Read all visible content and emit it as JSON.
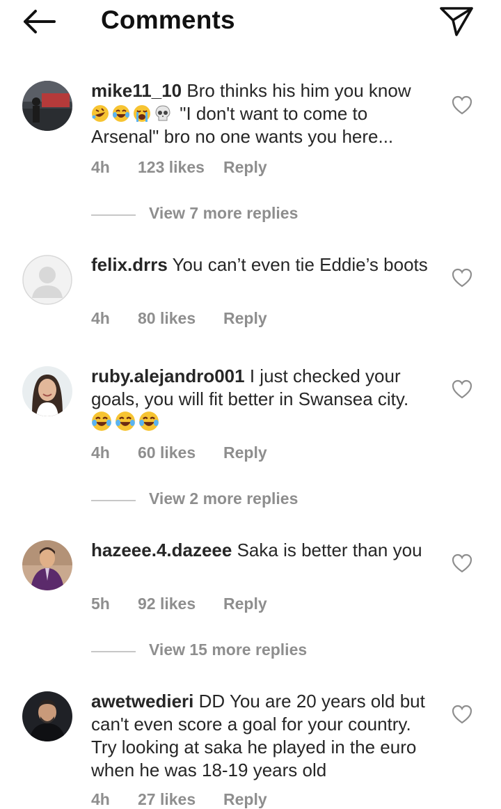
{
  "header": {
    "title": "Comments",
    "back_icon": "arrow-left-icon",
    "share_icon": "paper-plane-icon"
  },
  "comments": [
    {
      "username": "mike11_10",
      "text_before": "Bro thinks his him you know",
      "emojis": [
        "rolling-on-floor-laughing-emoji",
        "tears-of-joy-emoji",
        "loudly-crying-emoji",
        "skull-emoji"
      ],
      "text_after": " \"I don't want to come to Arsenal\" bro no one wants you here...",
      "time": "4h",
      "likes": "123 likes",
      "reply": "Reply",
      "view_more": "View 7 more replies"
    },
    {
      "username": "felix.drrs",
      "text": "You can’t even tie Eddie’s boots",
      "time": "4h",
      "likes": "80 likes",
      "reply": "Reply"
    },
    {
      "username": "ruby.alejandro001",
      "text": "I just checked your goals, you will fit better in Swansea city.",
      "emojis": [
        "tears-of-joy-emoji",
        "tears-of-joy-emoji",
        "tears-of-joy-emoji"
      ],
      "time": "4h",
      "likes": "60 likes",
      "reply": "Reply",
      "view_more": "View 2 more replies"
    },
    {
      "username": "hazeee.4.dazeee",
      "text": "Saka is better than you",
      "time": "5h",
      "likes": "92 likes",
      "reply": "Reply",
      "view_more": "View 15 more replies"
    },
    {
      "username": "awetwedieri",
      "text": "DD You are 20 years old but can't even score a goal for your country. Try looking at saka he played in the euro when he was 18-19 years old",
      "time": "4h",
      "likes": "27 likes",
      "reply": "Reply"
    }
  ],
  "colors": {
    "text": "#262626",
    "muted": "#8e8e8e",
    "divider": "#c7c7c7",
    "background": "#ffffff"
  }
}
